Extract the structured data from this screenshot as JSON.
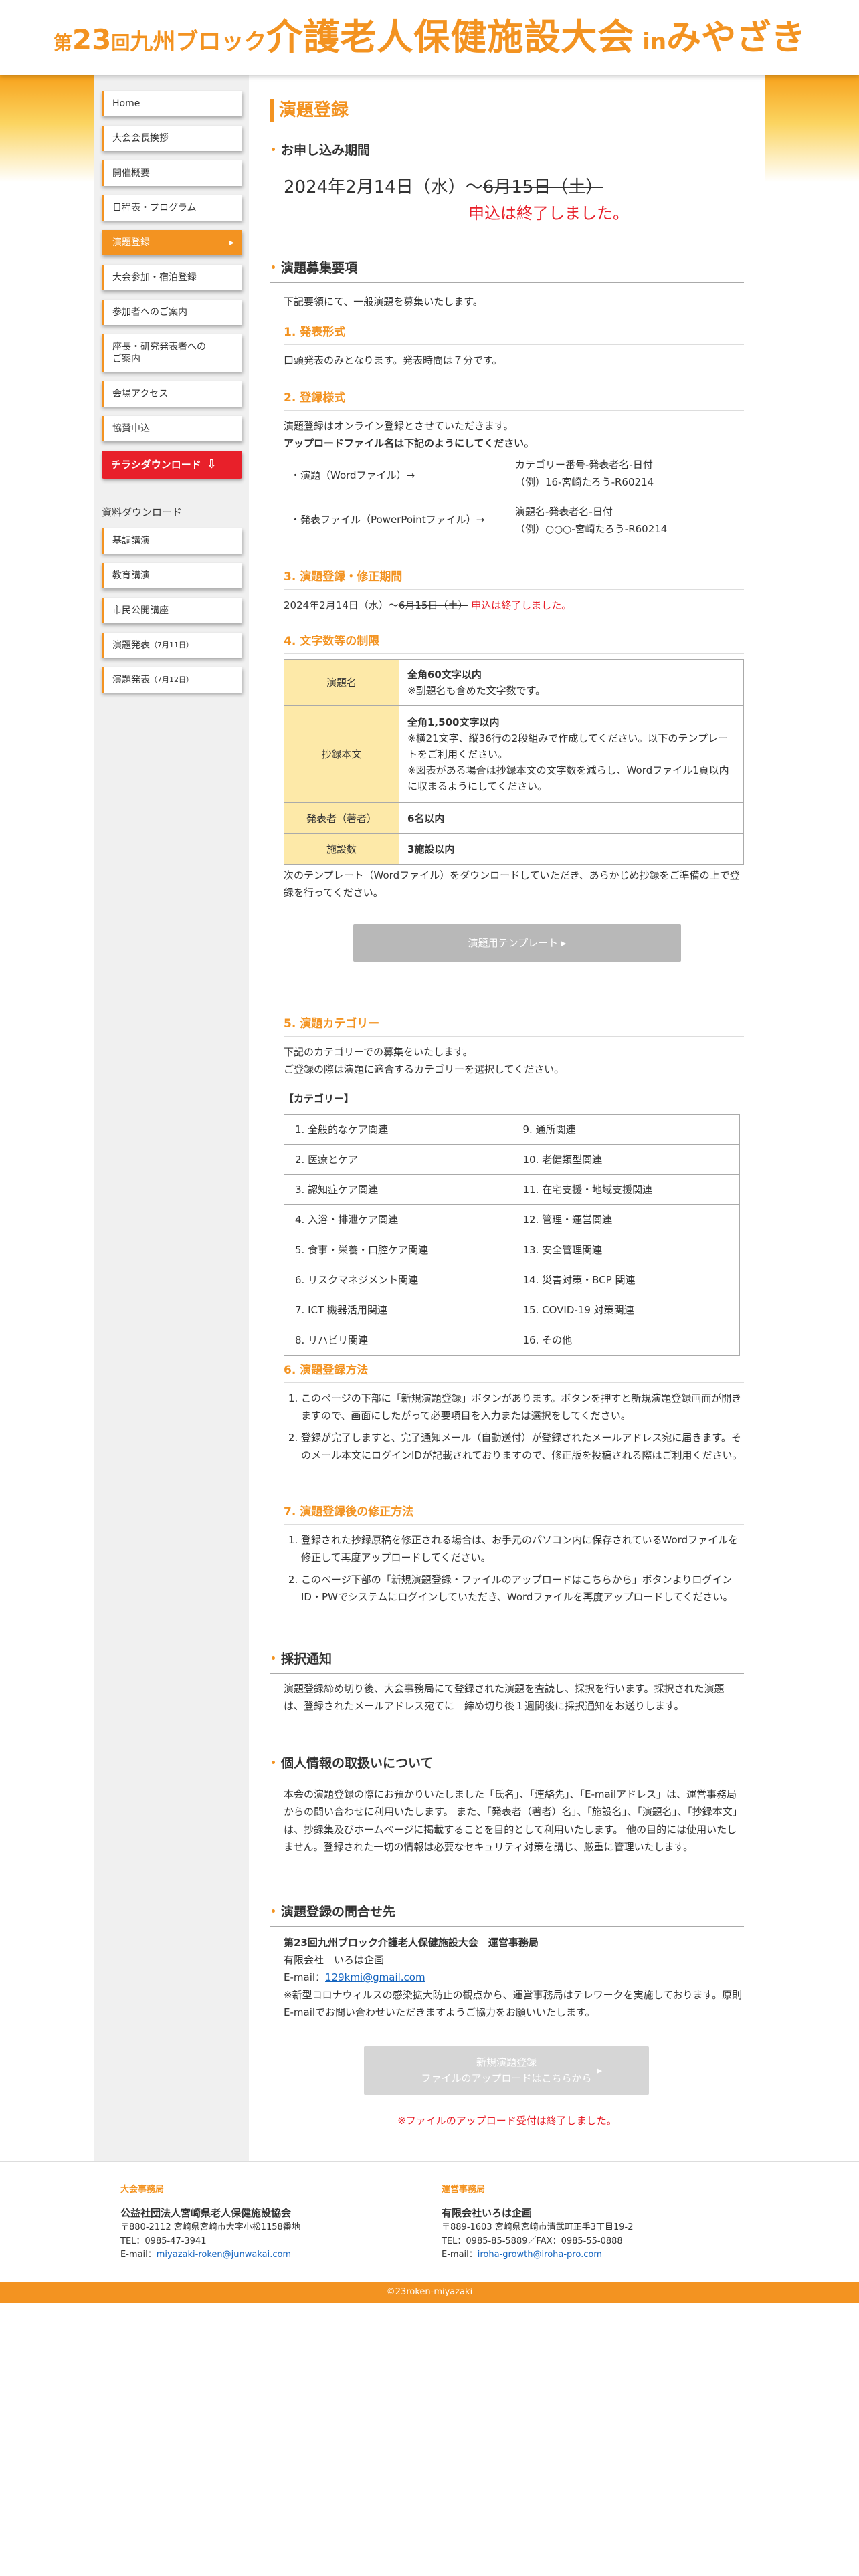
{
  "header": {
    "prefix": "第",
    "number": "23",
    "kai": "回",
    "block": "九州ブロック",
    "main": "介護老人保健施設大会",
    "in": " in",
    "place": "みやざき"
  },
  "sidebar": {
    "items": [
      {
        "label": "Home"
      },
      {
        "label": "大会会長挨拶"
      },
      {
        "label": "開催概要"
      },
      {
        "label": "日程表・プログラム"
      },
      {
        "label": "演題登録"
      },
      {
        "label": "大会参加・宿泊登録"
      },
      {
        "label": "参加者へのご案内"
      },
      {
        "label": "座長・研究発表者への\nご案内"
      },
      {
        "label": "会場アクセス"
      },
      {
        "label": "協賛申込"
      }
    ],
    "chirashi": "チラシダウンロード",
    "download_title": "資料ダウンロード",
    "downloads": [
      {
        "label": "基調講演",
        "note": ""
      },
      {
        "label": "教育講演",
        "note": ""
      },
      {
        "label": "市民公開講座",
        "note": ""
      },
      {
        "label": "演題発表",
        "note": "（7月11日）"
      },
      {
        "label": "演題発表",
        "note": "（7月12日）"
      }
    ]
  },
  "main": {
    "title": "演題登録",
    "s1": {
      "heading": "お申し込み期間",
      "date": "2024年2月14日（水）〜",
      "date_struck": "6月15日（土）",
      "closed": "申込は終了しました。"
    },
    "s2": {
      "heading": "演題募集要項",
      "intro": "下記要領にて、一般演題を募集いたします。",
      "h1": "1. 発表形式",
      "p1": "口頭発表のみとなります。発表時間は７分です。",
      "h2": "2. 登録様式",
      "p2a": "演題登録はオンライン登録とさせていただきます。",
      "p2b": "アップロードファイル名は下記のようにしてください。",
      "file1_label": "・演題（Wordファイル）→",
      "file1_val1": "カテゴリー番号-発表者名-日付",
      "file1_val2": "（例）16-宮崎たろう-R60214",
      "file2_label": "・発表ファイル（PowerPointファイル）→",
      "file2_val1": "演題名-発表者名-日付",
      "file2_val2": "（例）○○○-宮崎たろう-R60214",
      "h3": "3. 演題登録・修正期間",
      "p3_date": "2024年2月14日（水）〜",
      "p3_struck": "6月15日（土）",
      "p3_closed": "申込は終了しました。",
      "h4": "4. 文字数等の制限",
      "limits": [
        {
          "label": "演題名",
          "main": "全角60文字以内",
          "sub": "※副題名も含めた文字数です。"
        },
        {
          "label": "抄録本文",
          "main": "全角1,500文字以内",
          "sub": "※横21文字、縦36行の2段組みで作成してください。以下のテンプレートをご利用ください。",
          "sub2": "※図表がある場合は抄録本文の文字数を減らし、Wordファイル1頁以内に収まるようにしてください。"
        },
        {
          "label": "発表者（著者）",
          "main": "6名以内",
          "sub": ""
        },
        {
          "label": "施設数",
          "main": "3施設以内",
          "sub": ""
        }
      ],
      "template_note": "次のテンプレート（Wordファイル）をダウンロードしていただき、あらかじめ抄録をご準備の上で登録を行ってください。",
      "template_btn": "演題用テンプレート ▸",
      "h5": "5. 演題カテゴリー",
      "p5a": "下記のカテゴリーでの募集をいたします。",
      "p5b": "ご登録の際は演題に適合するカテゴリーを選択してください。",
      "cat_title": "【カテゴリー】",
      "categories": [
        [
          "1. 全般的なケア関連",
          "9. 通所関連"
        ],
        [
          "2. 医療とケア",
          "10. 老健類型関連"
        ],
        [
          "3. 認知症ケア関連",
          "11. 在宅支援・地域支援関連"
        ],
        [
          "4. 入浴・排泄ケア関連",
          "12. 管理・運営関連"
        ],
        [
          "5. 食事・栄養・口腔ケア関連",
          "13. 安全管理関連"
        ],
        [
          "6. リスクマネジメント関連",
          "14. 災害対策・BCP 関連"
        ],
        [
          "7. ICT 機器活用関連",
          "15. COVID-19 対策関連"
        ],
        [
          "8. リハビリ関連",
          "16. その他"
        ]
      ],
      "h6": "6. 演題登録方法",
      "p6": [
        "このページの下部に「新規演題登録」ボタンがあります。ボタンを押すと新規演題登録画面が開きますので、画面にしたがって必要項目を入力または選択をしてください。",
        "登録が完了しますと、完了通知メール（自動送付）が登録されたメールアドレス宛に届きます。そのメール本文にログインIDが記載されておりますので、修正版を投稿される際はご利用ください。"
      ],
      "h7": "7. 演題登録後の修正方法",
      "p7": [
        "登録された抄録原稿を修正される場合は、お手元のパソコン内に保存されているWordファイルを修正して再度アップロードしてください。",
        "このページ下部の「新規演題登録・ファイルのアップロードはこちらから」ボタンよりログインID・PWでシステムにログインしていただき、Wordファイルを再度アップロードしてください。"
      ]
    },
    "s3": {
      "heading": "採択通知",
      "text": "演題登録締め切り後、大会事務局にて登録された演題を査読し、採択を行います。採択された演題は、登録されたメールアドレス宛てに　締め切り後１週間後に採択通知をお送りします。"
    },
    "s4": {
      "heading": "個人情報の取扱いについて",
      "text": "本会の演題登録の際にお預かりいたしました「氏名」、「連絡先」、「E-mailアドレス」は、運営事務局からの問い合わせに利用いたします。 また、「発表者（著者）名」、「施設名」、「演題名」、「抄録本文」は、抄録集及びホームページに掲載することを目的として利用いたします。 他の目的には使用いたしません。登録された一切の情報は必要なセキュリティ対策を講じ、厳重に管理いたします。"
    },
    "s5": {
      "heading": "演題登録の問合せ先",
      "org": "第23回九州ブロック介護老人保健施設大会　運営事務局",
      "company": "有限会社　いろは企画",
      "email_label": "E-mail：",
      "email": "129kmi@gmail.com",
      "note": "※新型コロナウィルスの感染拡大防止の観点から、運営事務局はテレワークを実施しております。原則E-mailでお問い合わせいただきますようご協力をお願いいたします。"
    },
    "upload_btn_line1": "新規演題登録",
    "upload_btn_line2": "ファイルのアップロードはこちらから",
    "upload_closed": "※ファイルのアップロード受付は終了しました。"
  },
  "footer": {
    "left": {
      "heading": "大会事務局",
      "name": "公益社団法人宮崎県老人保健施設協会",
      "addr": "〒880-2112 宮崎県宮崎市大字小松1158番地",
      "tel": "TEL：0985-47-3941",
      "email_label": "E-mail：",
      "email": "miyazaki-roken@junwakai.com"
    },
    "right": {
      "heading": "運営事務局",
      "name": "有限会社いろは企画",
      "addr": "〒889-1603 宮崎県宮崎市清武町正手3丁目19-2",
      "tel": "TEL：0985-85-5889／FAX：0985-55-0888",
      "email_label": "E-mail：",
      "email": "iroha-growth@iroha-pro.com"
    }
  },
  "copyright": "©23roken-miyazaki",
  "colors": {
    "accent": "#f39321",
    "alert": "#e8202a",
    "highlight": "#fde9a8"
  }
}
